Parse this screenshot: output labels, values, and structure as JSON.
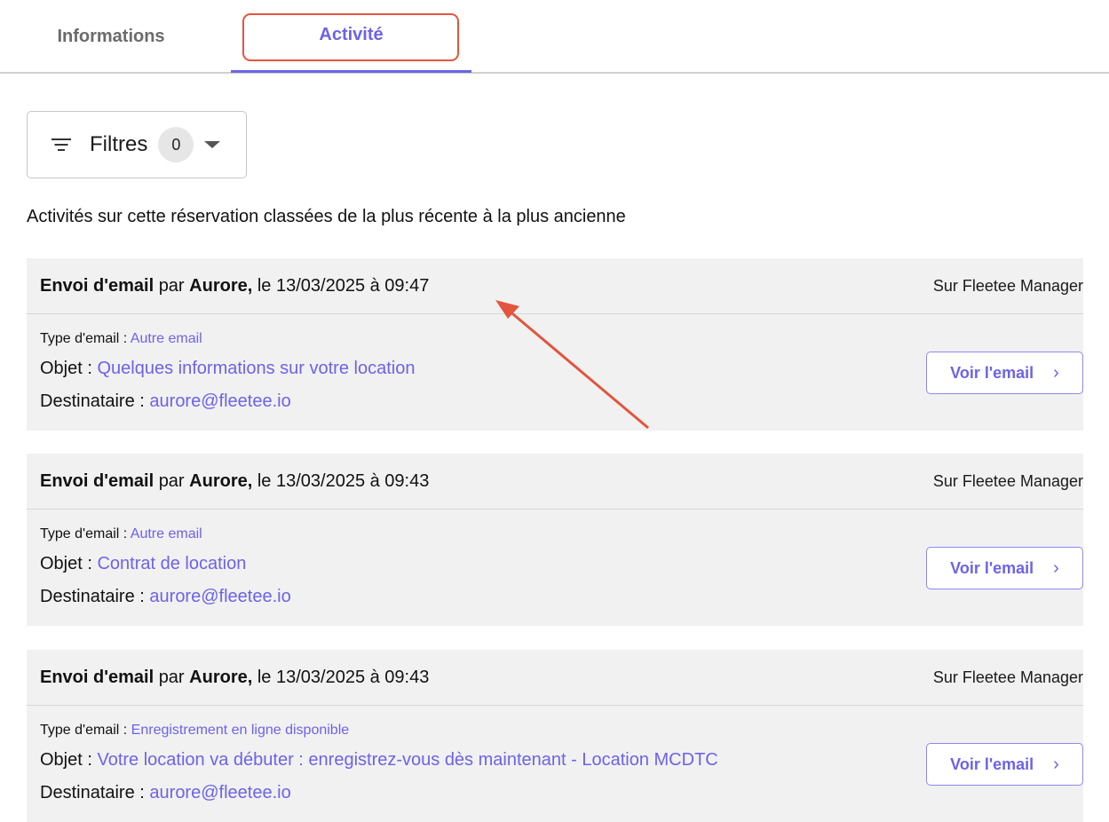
{
  "tabs": [
    {
      "label": "Informations",
      "active": false
    },
    {
      "label": "Activité",
      "active": true
    }
  ],
  "filters": {
    "label": "Filtres",
    "count": "0"
  },
  "intro": "Activités sur cette réservation classées de la plus récente à la plus ancienne",
  "colors": {
    "accent": "#6c63e8",
    "annotation": "#e2553e",
    "card_bg": "#f1f1f1"
  },
  "activities": [
    {
      "action": "Envoi d'email",
      "by": "par",
      "author": "Aurore,",
      "datetime": "le 13/03/2025 à 09:47",
      "source": "Sur Fleetee Manager",
      "type_label": "Type d'email :",
      "type_value": "Autre email",
      "subject_label": "Objet :",
      "subject_value": "Quelques informations sur votre location",
      "recipient_label": "Destinataire :",
      "recipient_value": "aurore@fleetee.io",
      "button": "Voir l'email"
    },
    {
      "action": "Envoi d'email",
      "by": "par",
      "author": "Aurore,",
      "datetime": "le 13/03/2025 à 09:43",
      "source": "Sur Fleetee Manager",
      "type_label": "Type d'email :",
      "type_value": "Autre email",
      "subject_label": "Objet :",
      "subject_value": "Contrat de location",
      "recipient_label": "Destinataire :",
      "recipient_value": "aurore@fleetee.io",
      "button": "Voir l'email"
    },
    {
      "action": "Envoi d'email",
      "by": "par",
      "author": "Aurore,",
      "datetime": "le 13/03/2025 à 09:43",
      "source": "Sur Fleetee Manager",
      "type_label": "Type d'email :",
      "type_value": "Enregistrement en ligne disponible",
      "subject_label": "Objet :",
      "subject_value": "Votre location va débuter : enregistrez-vous dès maintenant - Location MCDTC",
      "recipient_label": "Destinataire :",
      "recipient_value": "aurore@fleetee.io",
      "button": "Voir l'email"
    }
  ]
}
